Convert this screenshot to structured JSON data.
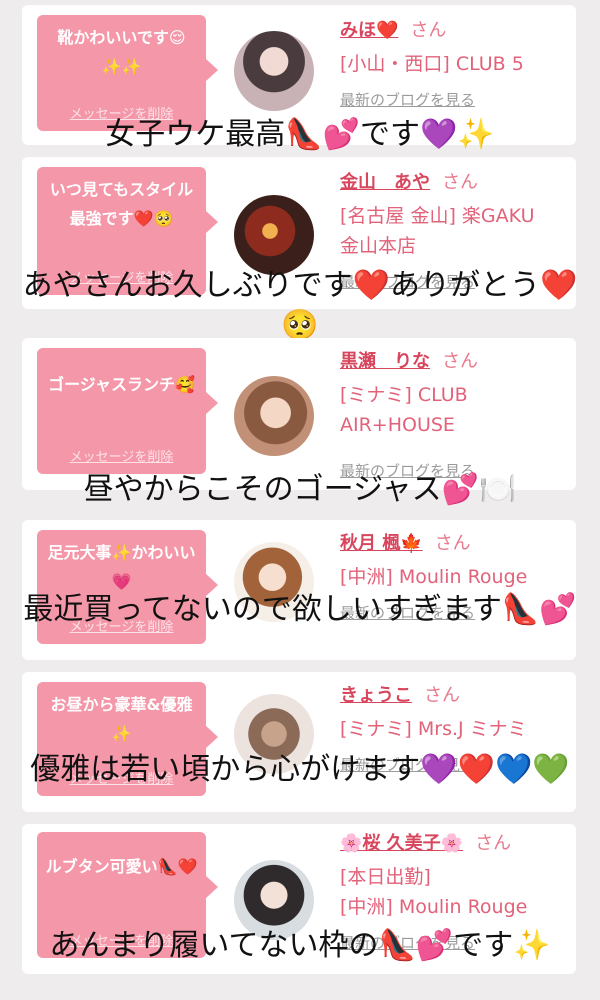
{
  "delete_label": "メッセージを削除",
  "blog_label": "最新のブログを見る",
  "san_label": "さん",
  "cards": [
    {
      "comment": "靴かわいいです😌✨✨",
      "name": "みほ❤️",
      "shop_lines": [
        "[小山・西口] CLUB 5"
      ],
      "caption": "女子ウケ最高👠💕です💜✨"
    },
    {
      "comment": "いつ見てもスタイル最強です❤️🥺",
      "name": "金山　あや",
      "shop_lines": [
        "[名古屋 金山] 楽GAKU",
        "金山本店"
      ],
      "caption": "あやさんお久しぶりです❤️ありがとう❤️🥺"
    },
    {
      "comment": "ゴージャスランチ🥰",
      "name": "黒瀬　りな",
      "shop_lines": [
        "[ミナミ] CLUB",
        "AIR+HOUSE"
      ],
      "caption": "昼やからこそのゴージャス💕🍽️"
    },
    {
      "comment": "足元大事✨かわいい💗",
      "name": "秋月 楓🍁",
      "shop_lines": [
        "[中洲] Moulin Rouge"
      ],
      "caption": "最近買ってないので欲しいすぎます👠💕"
    },
    {
      "comment": "お昼から豪華&優雅✨",
      "name": "きょうこ",
      "shop_lines": [
        "[ミナミ] Mrs.J ミナミ"
      ],
      "caption": "優雅は若い頃から心がけます💜❤️💙💚"
    },
    {
      "comment": "ルブタン可愛い👠❤️",
      "name": "🌸桜 久美子🌸",
      "shop_lines": [
        "[本日出勤]",
        "[中洲] Moulin Rouge"
      ],
      "caption": "あんまり履いてない枠の👠💕です✨"
    }
  ]
}
